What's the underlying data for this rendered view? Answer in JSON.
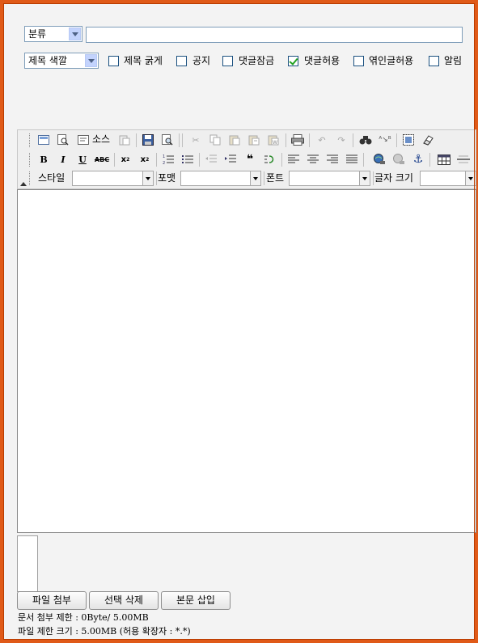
{
  "form": {
    "category_select": "분류",
    "title_color_select": "제목 색깔",
    "options": [
      {
        "label": "제목 굵게",
        "checked": false
      },
      {
        "label": "공지",
        "checked": false
      },
      {
        "label": "댓글잠금",
        "checked": false
      },
      {
        "label": "댓글허용",
        "checked": true
      },
      {
        "label": "엮인글허용",
        "checked": false
      },
      {
        "label": "알림",
        "checked": false
      }
    ]
  },
  "toolbar": {
    "source_label": "소스",
    "style_label": "스타일",
    "format_label": "포맷",
    "font_label": "폰트",
    "size_label": "글자 크기"
  },
  "attachments": {
    "attach_button": "파일 첨부",
    "delete_button": "선택 삭제",
    "insert_button": "본문 삽입",
    "doc_limit": "문서 첨부 제한 : 0Byte/ 5.00MB",
    "file_limit": "파일 제한 크기 : 5.00MB (허용 확장자 : *.*)"
  }
}
